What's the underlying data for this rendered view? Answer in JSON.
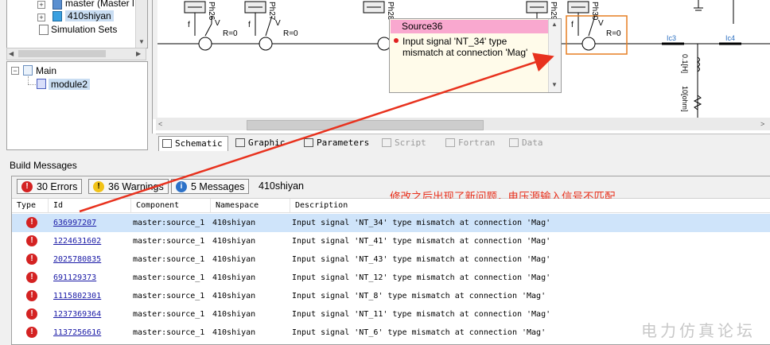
{
  "tree_top": {
    "items": [
      {
        "label": "master (Master l"
      },
      {
        "label": "410shiyan"
      },
      {
        "label": "Simulation Sets"
      }
    ]
  },
  "tree_bottom": {
    "items": [
      {
        "label": "Main"
      },
      {
        "label": "module2"
      }
    ]
  },
  "schematic": {
    "source_labels": [
      "Ph26",
      "Ph27",
      "Ph28",
      "Ph29",
      "Ph30"
    ],
    "r_label": "R=0",
    "f_label": "f",
    "v_label": "V",
    "ic_labels": [
      "Ic3",
      "Ic4"
    ],
    "inductor_label": "0.1[H]",
    "resistor_label": "10[ohm]"
  },
  "tooltip": {
    "title": "Source36",
    "message": "Input signal 'NT_34' type mismatch at connection 'Mag'"
  },
  "tabs": [
    {
      "label": "Schematic",
      "state": "active"
    },
    {
      "label": "Graphic",
      "state": "normal"
    },
    {
      "label": "Parameters",
      "state": "normal"
    },
    {
      "label": "Script",
      "state": "disabled"
    },
    {
      "label": "Fortran",
      "state": "disabled"
    },
    {
      "label": "Data",
      "state": "disabled"
    }
  ],
  "build_messages": {
    "title": "Build Messages",
    "filters": {
      "errors": "30 Errors",
      "warnings": "36 Warnings",
      "messages": "5 Messages"
    },
    "namespace_label": "410shiyan",
    "annotation": "修改之后出现了新问题，电压源输入信号不匹配",
    "columns": [
      "Type",
      "Id",
      "Component",
      "Namespace",
      "Description"
    ],
    "rows": [
      {
        "id": "636997207",
        "component": "master:source_1",
        "namespace": "410shiyan",
        "description": "Input signal 'NT_34' type mismatch at connection 'Mag'"
      },
      {
        "id": "1224631602",
        "component": "master:source_1",
        "namespace": "410shiyan",
        "description": "Input signal 'NT_41' type mismatch at connection 'Mag'"
      },
      {
        "id": "2025780835",
        "component": "master:source_1",
        "namespace": "410shiyan",
        "description": "Input signal 'NT_43' type mismatch at connection 'Mag'"
      },
      {
        "id": "691129373",
        "component": "master:source_1",
        "namespace": "410shiyan",
        "description": "Input signal 'NT_12' type mismatch at connection 'Mag'"
      },
      {
        "id": "1115802301",
        "component": "master:source_1",
        "namespace": "410shiyan",
        "description": "Input signal 'NT_8' type mismatch at connection 'Mag'"
      },
      {
        "id": "1237369364",
        "component": "master:source_1",
        "namespace": "410shiyan",
        "description": "Input signal 'NT_11' type mismatch at connection 'Mag'"
      },
      {
        "id": "1137256616",
        "component": "master:source_1",
        "namespace": "410shiyan",
        "description": "Input signal 'NT_6' type mismatch at connection 'Mag'"
      }
    ]
  },
  "watermark": "电力仿真论坛",
  "colors": {
    "annotation": "#e8321e",
    "tooltip_title_bg": "#f9a8cf",
    "selected_row": "#cfe4fa",
    "error_icon": "#d42222",
    "highlight_box": "#e67e22"
  }
}
